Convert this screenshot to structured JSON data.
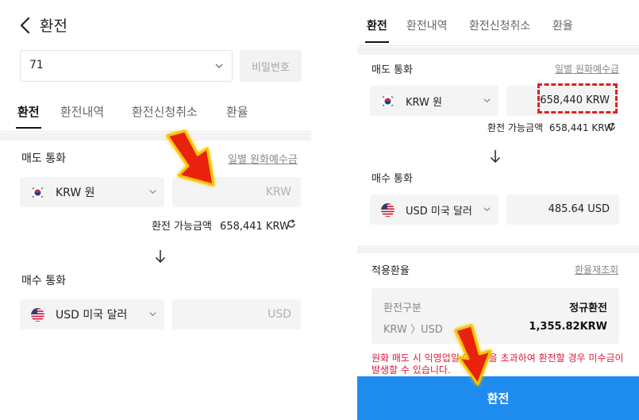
{
  "left": {
    "header": {
      "title": "환전"
    },
    "account": {
      "value": "71"
    },
    "password_button": "비밀번호",
    "tabs": [
      {
        "label": "환전",
        "active": true
      },
      {
        "label": "환전내역",
        "active": false
      },
      {
        "label": "환전신청취소",
        "active": false
      },
      {
        "label": "환율",
        "active": false
      }
    ],
    "sell": {
      "label": "매도 통화",
      "link": "일별 원화예수금",
      "currency": "KRW 원",
      "amount_placeholder": "KRW",
      "available_label": "환전 가능금액",
      "available_value": "658,441 KRW"
    },
    "buy": {
      "label": "매수 통화",
      "currency": "USD 미국 달러",
      "amount_placeholder": "USD"
    }
  },
  "right": {
    "tabs": [
      {
        "label": "환전",
        "active": true
      },
      {
        "label": "환전내역",
        "active": false
      },
      {
        "label": "환전신청취소",
        "active": false
      },
      {
        "label": "환율",
        "active": false
      }
    ],
    "sell": {
      "label": "매도 통화",
      "link": "일별 원화예수금",
      "currency": "KRW 원",
      "amount": "658,440 KRW",
      "available_label": "환전 가능금액",
      "available_value": "658,441 KRW"
    },
    "buy": {
      "label": "매수 통화",
      "currency": "USD 미국 달러",
      "amount": "485.64 USD"
    },
    "rate": {
      "label": "적용환율",
      "link": "환율재조회",
      "type_label": "환전구분",
      "type_value": "정규환전",
      "pair_label": "KRW 〉USD",
      "pair_value": "1,355.82KRW"
    },
    "warning": "원화 매도 시 익영업일 예수금을 초과하여 환전할 경우 미수금이 발생할 수 있습니다.",
    "exchange_button": "환전"
  },
  "colors": {
    "accent": "#1e8bef",
    "warning": "#e0193a",
    "highlight": "#e02020",
    "pointer_arrow": "#e8200a"
  },
  "icons": [
    "back-arrow",
    "chevron-down",
    "refresh",
    "arrow-down",
    "kr-flag",
    "us-flag",
    "pointer-arrow"
  ]
}
